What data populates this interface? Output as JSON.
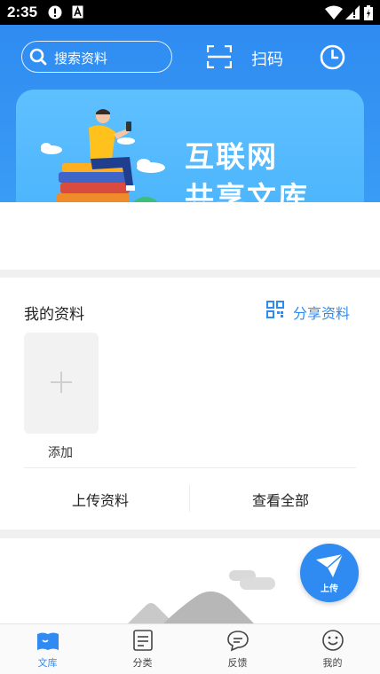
{
  "status_bar": {
    "time": "2:35"
  },
  "header": {
    "search_placeholder": "搜索资料",
    "scan_label": "扫码"
  },
  "banner": {
    "line1": "互联网",
    "line2": "共享文库"
  },
  "my_materials": {
    "title": "我的资料",
    "share_label": "分享资料",
    "add_label": "添加",
    "upload_label": "上传资料",
    "view_all_label": "查看全部"
  },
  "fab": {
    "label": "上传"
  },
  "tabbar": {
    "items": [
      {
        "label": "文库",
        "icon": "book-icon",
        "active": true
      },
      {
        "label": "分类",
        "icon": "list-icon",
        "active": false
      },
      {
        "label": "反馈",
        "icon": "chat-icon",
        "active": false
      },
      {
        "label": "我的",
        "icon": "smile-icon",
        "active": false
      }
    ]
  },
  "colors": {
    "primary": "#2f8bf1",
    "banner": "#53b8fd"
  }
}
